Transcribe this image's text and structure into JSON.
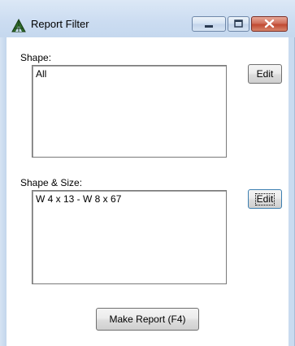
{
  "window": {
    "title": "Report Filter",
    "icon": "triangle-app-icon",
    "controls": {
      "minimize_icon": "minimize-icon",
      "maximize_icon": "maximize-icon",
      "close_icon": "close-icon"
    }
  },
  "shape": {
    "label": "Shape:",
    "items": [
      "All"
    ],
    "edit_label": "Edit"
  },
  "shape_size": {
    "label": "Shape & Size:",
    "items": [
      "W 4 x 13 - W 8 x 67"
    ],
    "edit_label": "Edit"
  },
  "make_report_label": "Make Report (F4)",
  "colors": {
    "titlebar": "#c9dbf0",
    "close_button": "#c14a32",
    "window_bg": "#ffffff"
  }
}
